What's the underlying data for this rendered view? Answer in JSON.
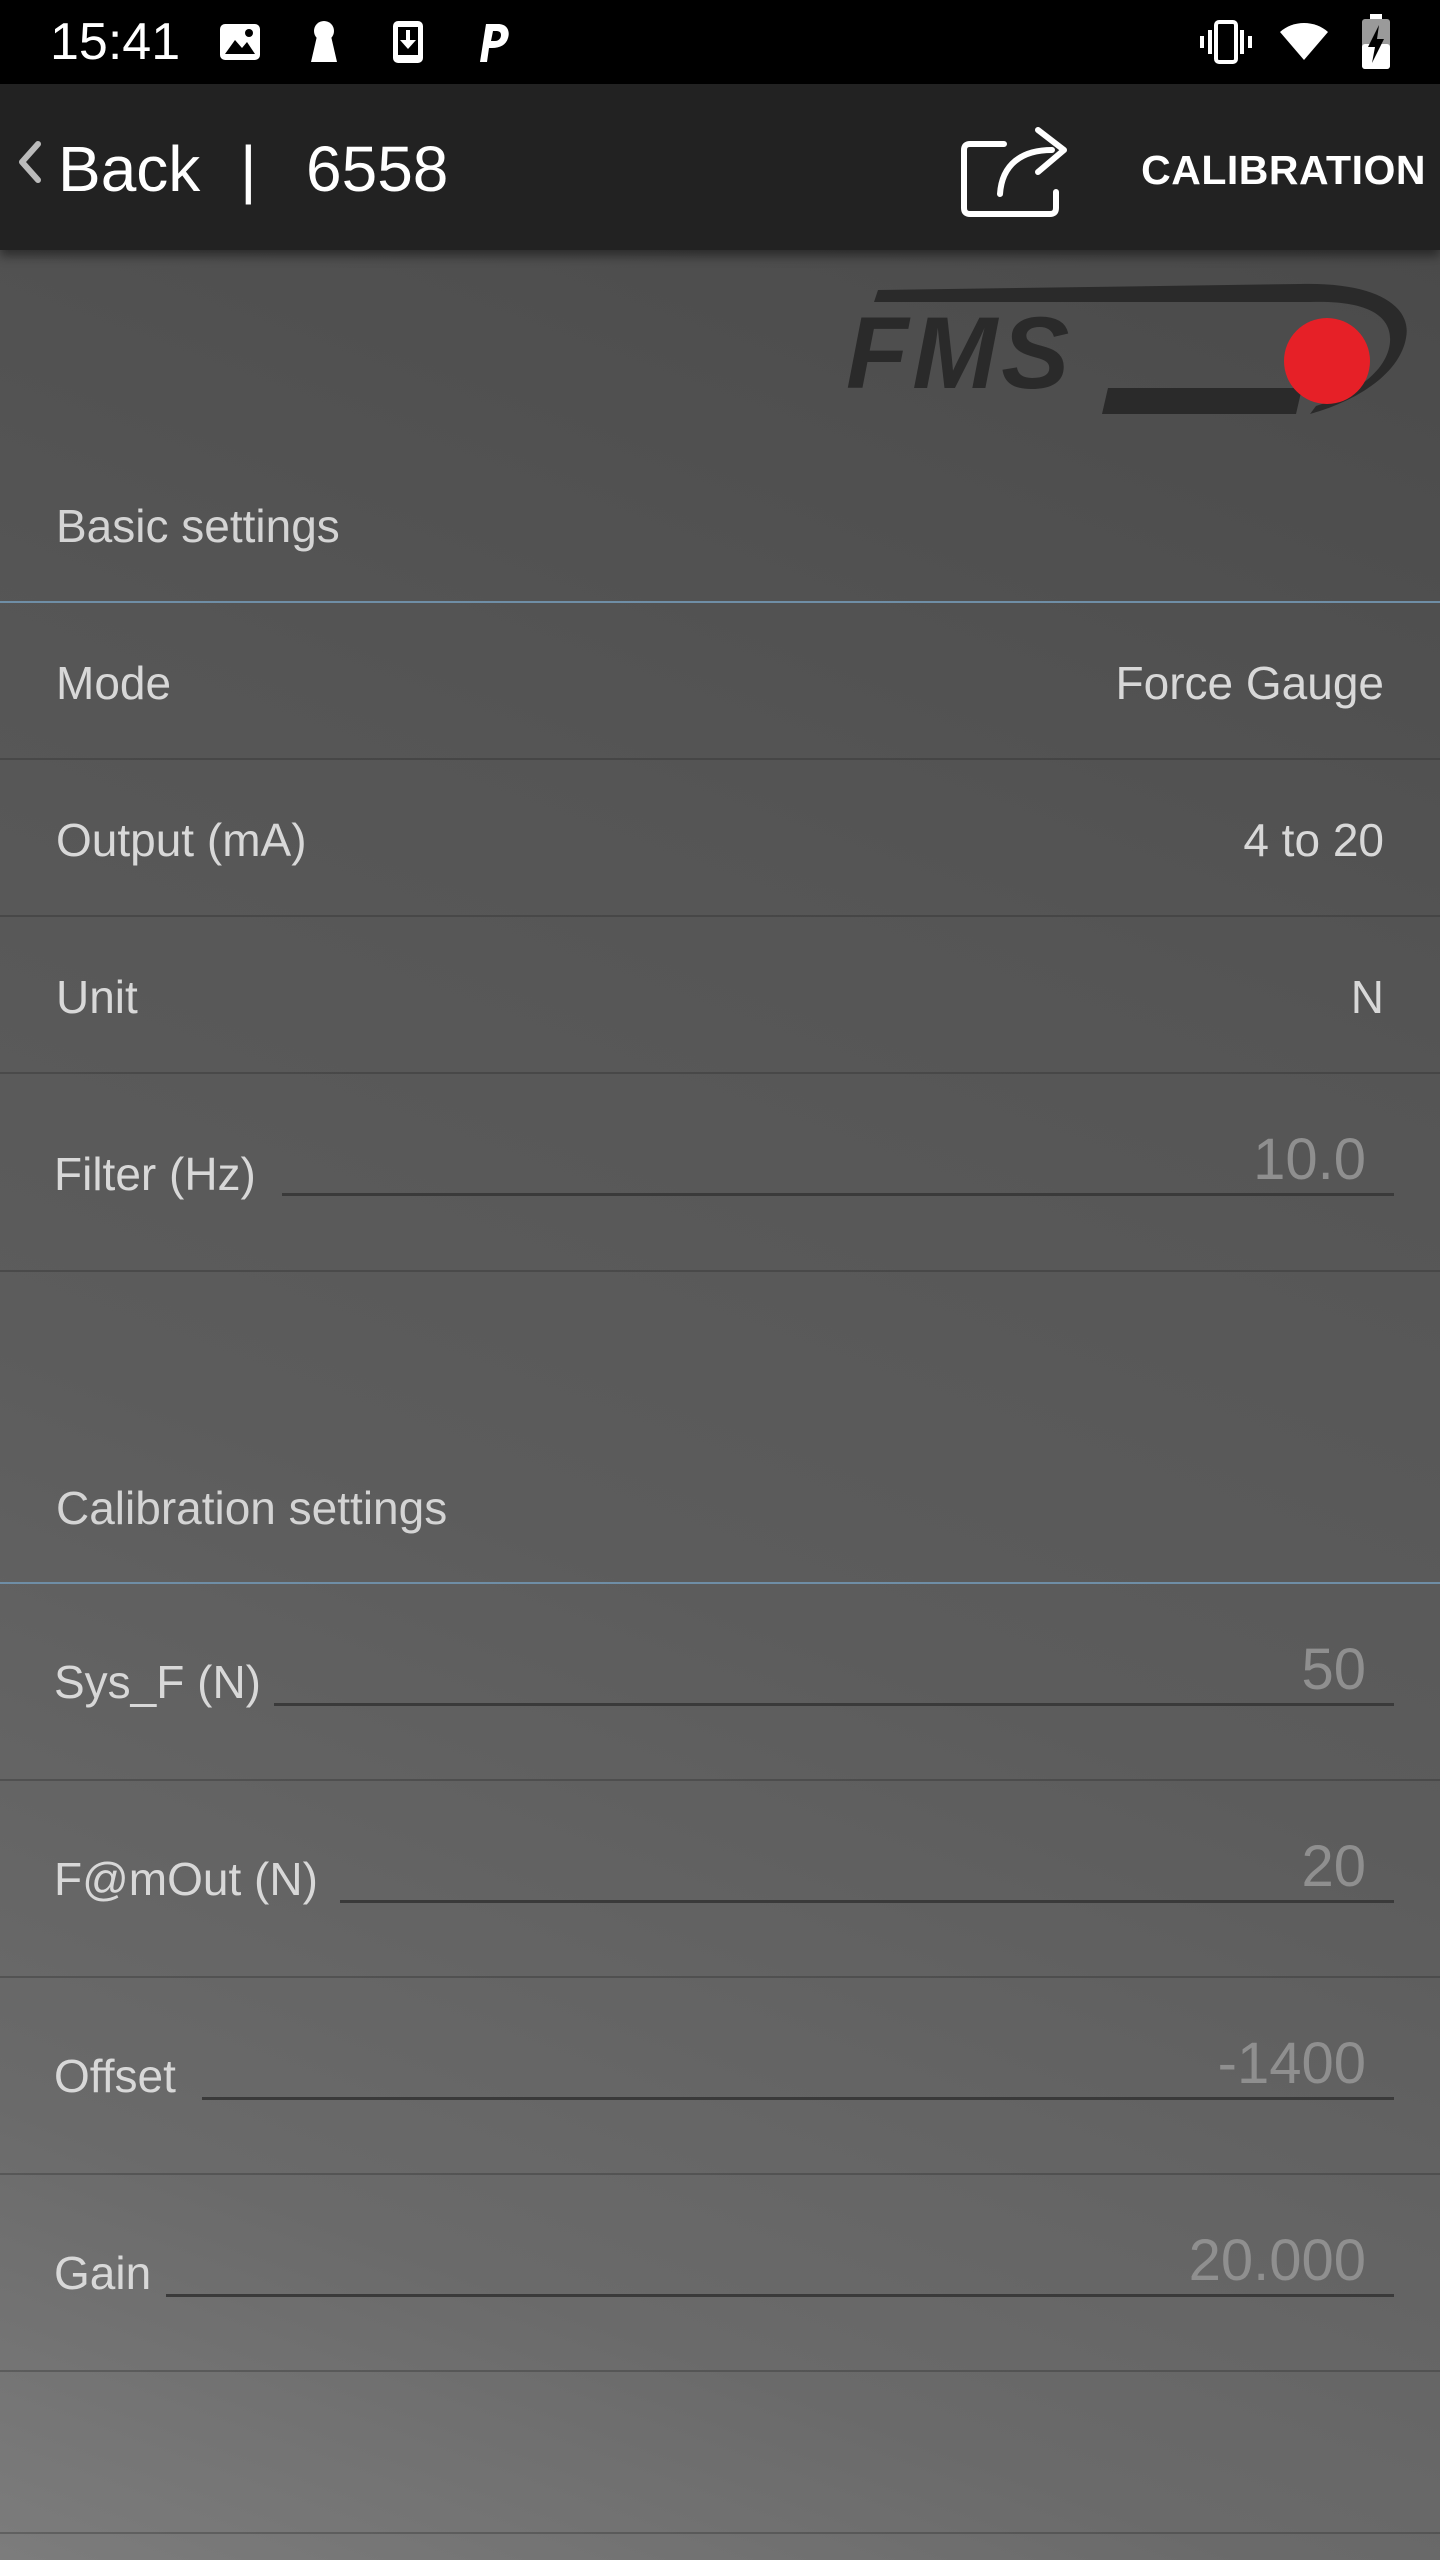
{
  "status_bar": {
    "time": "15:41",
    "left_icons": [
      "image-icon",
      "keyhole-icon",
      "download-icon",
      "p-icon"
    ],
    "right_icons": [
      "vibrate-icon",
      "wifi-icon",
      "battery-charging-icon"
    ]
  },
  "app_bar": {
    "back_label": "Back",
    "separator": "|",
    "device_id": "6558",
    "share_icon": "share-icon",
    "calibration_label": "CALIBRATION"
  },
  "logo": {
    "text": "FMS",
    "accent_color": "#e62027"
  },
  "basic_settings": {
    "title": "Basic settings",
    "mode": {
      "label": "Mode",
      "value": "Force Gauge"
    },
    "output": {
      "label": "Output (mA)",
      "value": "4 to 20"
    },
    "unit": {
      "label": "Unit",
      "value": "N"
    },
    "filter": {
      "label": "Filter (Hz)",
      "value": "10.0"
    }
  },
  "calibration_settings": {
    "title": "Calibration settings",
    "sys_f": {
      "label": "Sys_F (N)",
      "value": "50"
    },
    "f_mout": {
      "label": "F@mOut (N)",
      "value": "20"
    },
    "offset": {
      "label": "Offset",
      "value": "-1400"
    },
    "gain": {
      "label": "Gain",
      "value": "20.000"
    }
  },
  "colors": {
    "status_bar": "#000000",
    "app_bar": "#222222",
    "section_divider": "#6f8ea6",
    "text_primary": "#d8d8d8",
    "input_text": "#8f8f8f"
  }
}
